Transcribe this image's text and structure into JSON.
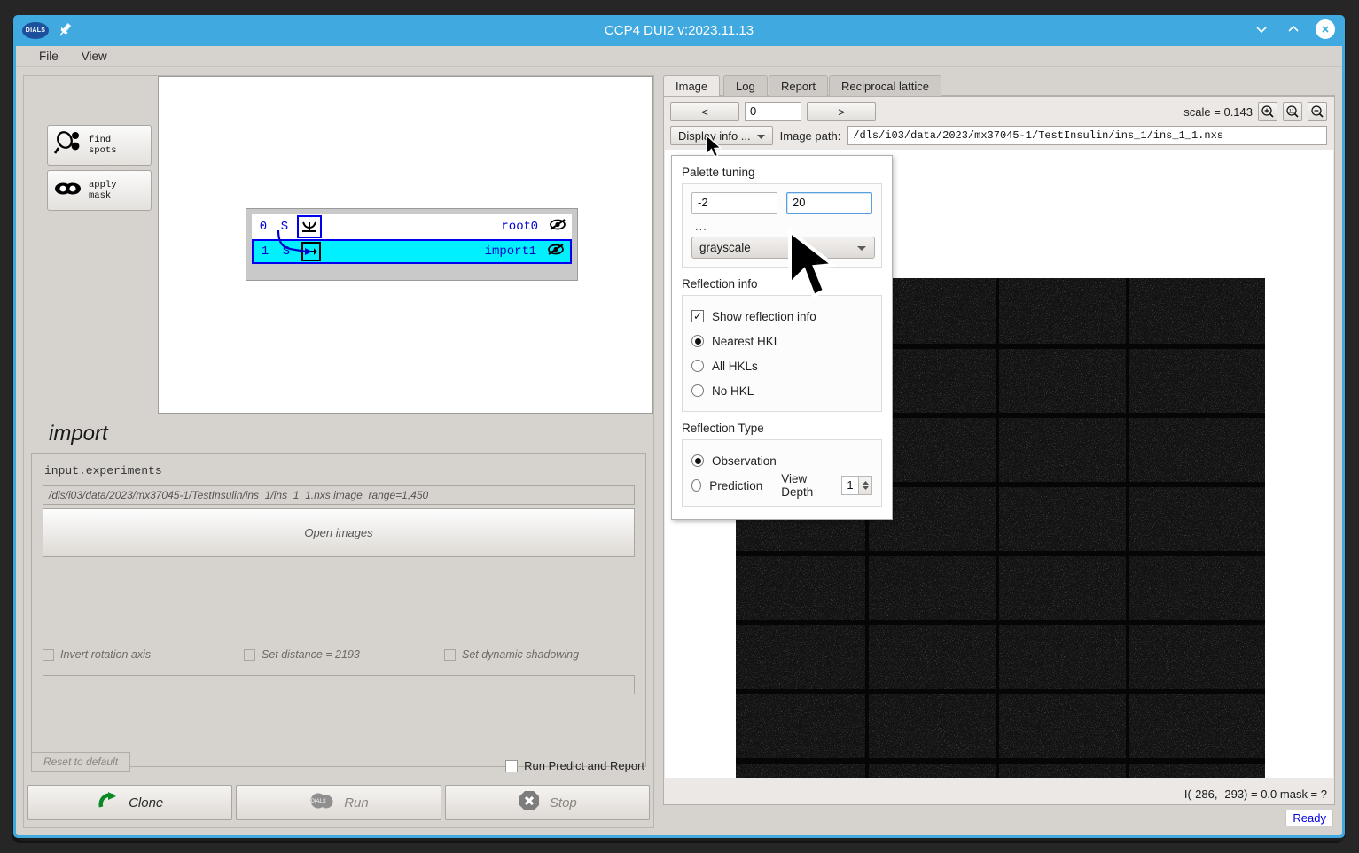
{
  "window": {
    "title": "CCP4 DUI2 v:2023.11.13",
    "logo_text": "DIALS",
    "pin_icon": "pin-icon",
    "minimize_icon": "chevron-down-icon",
    "maximize_icon": "chevron-up-icon",
    "close_icon": "close-icon",
    "titlebar_color": "#3fa9e0"
  },
  "menubar": {
    "items": [
      {
        "label": "File"
      },
      {
        "label": "View"
      }
    ]
  },
  "left": {
    "tools": [
      {
        "label_line1": "find",
        "label_line2": "spots",
        "icon": "find-spots-icon"
      },
      {
        "label_line1": "apply",
        "label_line2": "mask",
        "icon": "apply-mask-icon"
      }
    ],
    "tree": {
      "rows": [
        {
          "index": "0",
          "flag": "S",
          "name": "root",
          "count": "0",
          "icon": "root-node-icon",
          "eye": "eye-slash-icon",
          "selected": false
        },
        {
          "index": "1",
          "flag": "S",
          "name": "import",
          "count": "1",
          "icon": "import-node-icon",
          "eye": "eye-slash-icon",
          "selected": true
        }
      ]
    },
    "form": {
      "title": "import",
      "field_label": "input.experiments",
      "path_value": "/dls/i03/data/2023/mx37045-1/TestInsulin/ins_1/ins_1_1.nxs image_range=1,450",
      "open_button": "Open images",
      "checkboxes": [
        {
          "label": "Invert rotation axis",
          "checked": false
        },
        {
          "label": "Set distance = 2193",
          "checked": false
        },
        {
          "label": "Set dynamic shadowing",
          "checked": false
        }
      ],
      "blank_field_value": ""
    },
    "reset_button": "Reset to default",
    "run_predict_checkbox": {
      "label": "Run Predict and Report",
      "checked": false
    },
    "buttons": [
      {
        "label": "Clone",
        "icon": "clone-arrow-icon",
        "disabled": false
      },
      {
        "label": "Run",
        "icon": "dials-run-icon",
        "disabled": true
      },
      {
        "label": "Stop",
        "icon": "stop-octagon-icon",
        "disabled": true
      }
    ]
  },
  "right": {
    "tabs": [
      {
        "label": "Image",
        "active": true
      },
      {
        "label": "Log",
        "active": false
      },
      {
        "label": "Report",
        "active": false
      },
      {
        "label": "Reciprocal lattice",
        "active": false
      }
    ],
    "nav": {
      "prev": "<",
      "frame_value": "0",
      "next": ">"
    },
    "scale_text": "scale = 0.143",
    "zoom_buttons": [
      {
        "icon": "zoom-in-icon"
      },
      {
        "icon": "zoom-one-to-one-icon"
      },
      {
        "icon": "zoom-out-icon"
      }
    ],
    "display_info_button": {
      "label": "Display info ...",
      "caret": "chevron-down-icon"
    },
    "image_path_label": "Image path:",
    "image_path_value": "/dls/i03/data/2023/mx37045-1/TestInsulin/ins_1/ins_1_1.nxs",
    "status": "I(-286, -293) =     0.0  mask = ?",
    "ready_label": "Ready",
    "ready_color": "#0000dd"
  },
  "popup": {
    "palette": {
      "heading": "Palette tuning",
      "min_value": "-2",
      "max_value": "20",
      "dots": "...",
      "colormap": "grayscale"
    },
    "reflection_info": {
      "heading": "Reflection info",
      "show_checkbox": {
        "label": "Show reflection info",
        "checked": true
      },
      "options": [
        {
          "label": "Nearest HKL",
          "selected": true
        },
        {
          "label": "All HKLs",
          "selected": false
        },
        {
          "label": "No HKL",
          "selected": false
        }
      ]
    },
    "reflection_type": {
      "heading": "Reflection Type",
      "options": [
        {
          "label": "Observation",
          "selected": true
        },
        {
          "label": "Prediction",
          "selected": false
        }
      ],
      "view_depth_label": "View Depth",
      "view_depth_value": "1"
    }
  }
}
